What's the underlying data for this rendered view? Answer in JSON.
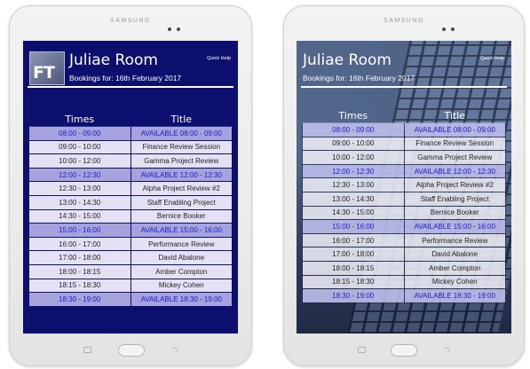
{
  "device_brand": "SAMSUNG",
  "app": {
    "logo_text": "FT",
    "room_name": "Juliae Room",
    "bookings_label": "Bookings for: 16th February 2017",
    "quick_help": "Quick Help"
  },
  "table": {
    "columns": [
      "Times",
      "Title"
    ],
    "rows": [
      {
        "time": "08:00 - 09:00",
        "title": "AVAILABLE 08:00 - 09:00",
        "available": true
      },
      {
        "time": "09:00 - 10:00",
        "title": "Finance Review Session",
        "available": false
      },
      {
        "time": "10:00 - 12:00",
        "title": "Gamma Project Review",
        "available": false
      },
      {
        "time": "12:00 - 12:30",
        "title": "AVAILABLE 12:00 - 12:30",
        "available": true
      },
      {
        "time": "12:30 - 13:00",
        "title": "Alpha Project Review #2",
        "available": false
      },
      {
        "time": "13:00 - 14:30",
        "title": "Staff Enabling Project",
        "available": false
      },
      {
        "time": "14:30 - 15:00",
        "title": "Bernice Booker",
        "available": false
      },
      {
        "time": "15:00 - 16:00",
        "title": "AVAILABLE 15:00 - 16:00",
        "available": true
      },
      {
        "time": "16:00 - 17:00",
        "title": "Performance Review",
        "available": false
      },
      {
        "time": "17:00 - 18:00",
        "title": "David Abalone",
        "available": false
      },
      {
        "time": "18:00 - 18:15",
        "title": "Amber Compton",
        "available": false
      },
      {
        "time": "18:15 - 18:30",
        "title": "Mickey Cohen",
        "available": false
      },
      {
        "time": "18:30 - 19:00",
        "title": "AVAILABLE 18:30 - 19:00",
        "available": true
      }
    ]
  },
  "nav": {
    "back_glyph": "⮌"
  },
  "colors": {
    "screen_background": "#0c0f6e",
    "available_row": "#a6a2dd",
    "available_text": "#1a1acb",
    "booked_row": "#e4e1f5"
  }
}
